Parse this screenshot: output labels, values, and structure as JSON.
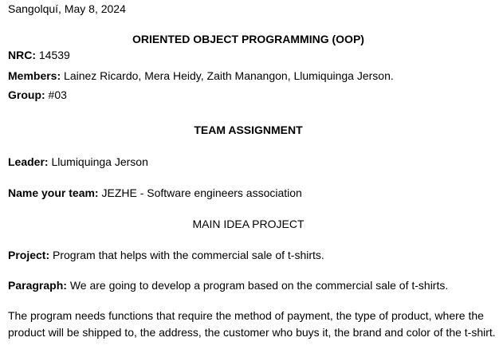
{
  "header": {
    "place_date": "Sangolquí, May 8, 2024",
    "course_title": "ORIENTED OBJECT PROGRAMMING (OOP)"
  },
  "info": {
    "nrc_label": "NRC:",
    "nrc_value": "14539",
    "members_label": "Members:",
    "members_value": "Lainez Ricardo, Mera Heidy, Zaith Manangon, Llumiquinga Jerson.",
    "group_label": "Group:",
    "group_value": "#03"
  },
  "assignment": {
    "title": "TEAM ASSIGNMENT",
    "leader_label": "Leader:",
    "leader_value": "Llumiquinga Jerson",
    "team_label": "Name your team:",
    "team_value": "JEZHE - Software engineers association",
    "main_idea_title": "MAIN IDEA PROJECT",
    "project_label": "Project:",
    "project_value": "Program that helps with the commercial sale of t-shirts.",
    "paragraph_label": "Paragraph:",
    "paragraph_value": "We are going to develop a program based on the commercial sale of t-shirts.",
    "body_text": "The program needs functions that require the method of payment, the type of product, where the product will be shipped to, the address, the customer who buys it, the brand and color of the t-shirt."
  }
}
